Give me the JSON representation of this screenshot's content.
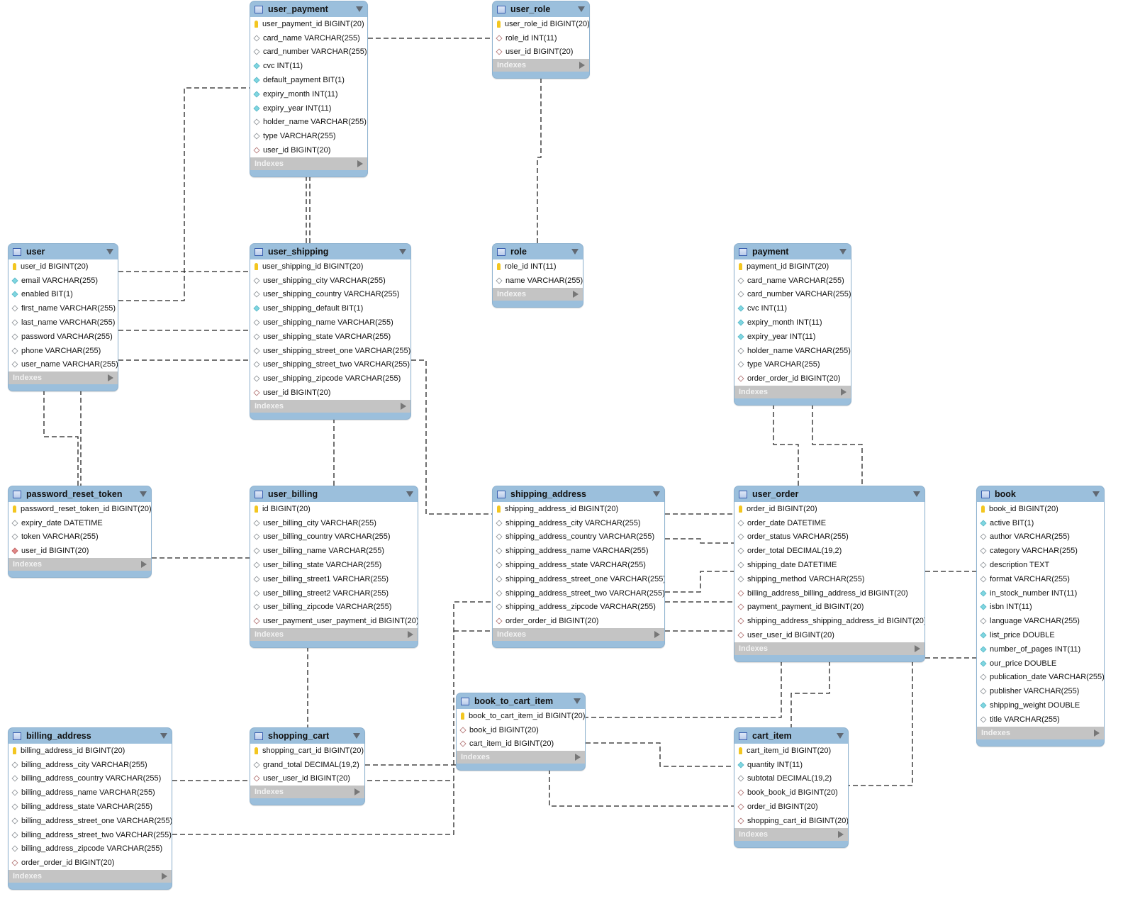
{
  "indexes_label": "Indexes",
  "colors": {
    "header": "#9bbfdc",
    "indexes": "#c4c4c4",
    "primary_key": "#f3c620",
    "not_null": "#7fd6e0",
    "foreign_key": "#b07070"
  },
  "icon_legend": {
    "pk": "key-icon",
    "col": "column-diamond-icon",
    "nn": "not-null-diamond-icon",
    "fk": "foreign-key-diamond-icon",
    "fknn": "foreign-key-filled-diamond-icon"
  },
  "tables": [
    {
      "id": "user_payment",
      "name": "user_payment",
      "columns": [
        {
          "text": "user_payment_id BIGINT(20)",
          "icon": "pk"
        },
        {
          "text": "card_name VARCHAR(255)",
          "icon": "col"
        },
        {
          "text": "card_number VARCHAR(255)",
          "icon": "col"
        },
        {
          "text": "cvc INT(11)",
          "icon": "nn"
        },
        {
          "text": "default_payment BIT(1)",
          "icon": "nn"
        },
        {
          "text": "expiry_month INT(11)",
          "icon": "nn"
        },
        {
          "text": "expiry_year INT(11)",
          "icon": "nn"
        },
        {
          "text": "holder_name VARCHAR(255)",
          "icon": "col"
        },
        {
          "text": "type VARCHAR(255)",
          "icon": "col"
        },
        {
          "text": "user_id BIGINT(20)",
          "icon": "fk"
        }
      ]
    },
    {
      "id": "user_role",
      "name": "user_role",
      "columns": [
        {
          "text": "user_role_id BIGINT(20)",
          "icon": "pk"
        },
        {
          "text": "role_id INT(11)",
          "icon": "fk"
        },
        {
          "text": "user_id BIGINT(20)",
          "icon": "fk"
        }
      ]
    },
    {
      "id": "user",
      "name": "user",
      "columns": [
        {
          "text": "user_id BIGINT(20)",
          "icon": "pk"
        },
        {
          "text": "email VARCHAR(255)",
          "icon": "nn"
        },
        {
          "text": "enabled BIT(1)",
          "icon": "nn"
        },
        {
          "text": "first_name VARCHAR(255)",
          "icon": "col"
        },
        {
          "text": "last_name VARCHAR(255)",
          "icon": "col"
        },
        {
          "text": "password VARCHAR(255)",
          "icon": "col"
        },
        {
          "text": "phone VARCHAR(255)",
          "icon": "col"
        },
        {
          "text": "user_name VARCHAR(255)",
          "icon": "col"
        }
      ]
    },
    {
      "id": "user_shipping",
      "name": "user_shipping",
      "columns": [
        {
          "text": "user_shipping_id BIGINT(20)",
          "icon": "pk"
        },
        {
          "text": "user_shipping_city VARCHAR(255)",
          "icon": "col"
        },
        {
          "text": "user_shipping_country VARCHAR(255)",
          "icon": "col"
        },
        {
          "text": "user_shipping_default BIT(1)",
          "icon": "nn"
        },
        {
          "text": "user_shipping_name VARCHAR(255)",
          "icon": "col"
        },
        {
          "text": "user_shipping_state VARCHAR(255)",
          "icon": "col"
        },
        {
          "text": "user_shipping_street_one VARCHAR(255)",
          "icon": "col"
        },
        {
          "text": "user_shipping_street_two VARCHAR(255)",
          "icon": "col"
        },
        {
          "text": "user_shipping_zipcode VARCHAR(255)",
          "icon": "col"
        },
        {
          "text": "user_id BIGINT(20)",
          "icon": "fk"
        }
      ]
    },
    {
      "id": "role",
      "name": "role",
      "columns": [
        {
          "text": "role_id INT(11)",
          "icon": "pk"
        },
        {
          "text": "name VARCHAR(255)",
          "icon": "col"
        }
      ]
    },
    {
      "id": "payment",
      "name": "payment",
      "columns": [
        {
          "text": "payment_id BIGINT(20)",
          "icon": "pk"
        },
        {
          "text": "card_name VARCHAR(255)",
          "icon": "col"
        },
        {
          "text": "card_number VARCHAR(255)",
          "icon": "col"
        },
        {
          "text": "cvc INT(11)",
          "icon": "nn"
        },
        {
          "text": "expiry_month INT(11)",
          "icon": "nn"
        },
        {
          "text": "expiry_year INT(11)",
          "icon": "nn"
        },
        {
          "text": "holder_name VARCHAR(255)",
          "icon": "col"
        },
        {
          "text": "type VARCHAR(255)",
          "icon": "col"
        },
        {
          "text": "order_order_id BIGINT(20)",
          "icon": "fk"
        }
      ]
    },
    {
      "id": "password_reset_token",
      "name": "password_reset_token",
      "columns": [
        {
          "text": "password_reset_token_id BIGINT(20)",
          "icon": "pk"
        },
        {
          "text": "expiry_date DATETIME",
          "icon": "col"
        },
        {
          "text": "token VARCHAR(255)",
          "icon": "col"
        },
        {
          "text": "user_id BIGINT(20)",
          "icon": "fknn"
        }
      ]
    },
    {
      "id": "user_billing",
      "name": "user_billing",
      "columns": [
        {
          "text": "id BIGINT(20)",
          "icon": "pk"
        },
        {
          "text": "user_billing_city VARCHAR(255)",
          "icon": "col"
        },
        {
          "text": "user_billing_country VARCHAR(255)",
          "icon": "col"
        },
        {
          "text": "user_billing_name VARCHAR(255)",
          "icon": "col"
        },
        {
          "text": "user_billing_state VARCHAR(255)",
          "icon": "col"
        },
        {
          "text": "user_billing_street1 VARCHAR(255)",
          "icon": "col"
        },
        {
          "text": "user_billing_street2 VARCHAR(255)",
          "icon": "col"
        },
        {
          "text": "user_billing_zipcode VARCHAR(255)",
          "icon": "col"
        },
        {
          "text": "user_payment_user_payment_id BIGINT(20)",
          "icon": "fk"
        }
      ]
    },
    {
      "id": "shipping_address",
      "name": "shipping_address",
      "columns": [
        {
          "text": "shipping_address_id BIGINT(20)",
          "icon": "pk"
        },
        {
          "text": "shipping_address_city VARCHAR(255)",
          "icon": "col"
        },
        {
          "text": "shipping_address_country VARCHAR(255)",
          "icon": "col"
        },
        {
          "text": "shipping_address_name VARCHAR(255)",
          "icon": "col"
        },
        {
          "text": "shipping_address_state VARCHAR(255)",
          "icon": "col"
        },
        {
          "text": "shipping_address_street_one VARCHAR(255)",
          "icon": "col"
        },
        {
          "text": "shipping_address_street_two VARCHAR(255)",
          "icon": "col"
        },
        {
          "text": "shipping_address_zipcode VARCHAR(255)",
          "icon": "col"
        },
        {
          "text": "order_order_id BIGINT(20)",
          "icon": "fk"
        }
      ]
    },
    {
      "id": "user_order",
      "name": "user_order",
      "columns": [
        {
          "text": "order_id BIGINT(20)",
          "icon": "pk"
        },
        {
          "text": "order_date DATETIME",
          "icon": "col"
        },
        {
          "text": "order_status VARCHAR(255)",
          "icon": "col"
        },
        {
          "text": "order_total DECIMAL(19,2)",
          "icon": "col"
        },
        {
          "text": "shipping_date DATETIME",
          "icon": "col"
        },
        {
          "text": "shipping_method VARCHAR(255)",
          "icon": "col"
        },
        {
          "text": "billing_address_billing_address_id BIGINT(20)",
          "icon": "fk"
        },
        {
          "text": "payment_payment_id BIGINT(20)",
          "icon": "fk"
        },
        {
          "text": "shipping_address_shipping_address_id BIGINT(20)",
          "icon": "fk"
        },
        {
          "text": "user_user_id BIGINT(20)",
          "icon": "fk"
        }
      ]
    },
    {
      "id": "book",
      "name": "book",
      "columns": [
        {
          "text": "book_id BIGINT(20)",
          "icon": "pk"
        },
        {
          "text": "active BIT(1)",
          "icon": "nn"
        },
        {
          "text": "author VARCHAR(255)",
          "icon": "col"
        },
        {
          "text": "category VARCHAR(255)",
          "icon": "col"
        },
        {
          "text": "description TEXT",
          "icon": "col"
        },
        {
          "text": "format VARCHAR(255)",
          "icon": "col"
        },
        {
          "text": "in_stock_number INT(11)",
          "icon": "nn"
        },
        {
          "text": "isbn INT(11)",
          "icon": "nn"
        },
        {
          "text": "language VARCHAR(255)",
          "icon": "col"
        },
        {
          "text": "list_price DOUBLE",
          "icon": "nn"
        },
        {
          "text": "number_of_pages INT(11)",
          "icon": "nn"
        },
        {
          "text": "our_price DOUBLE",
          "icon": "nn"
        },
        {
          "text": "publication_date VARCHAR(255)",
          "icon": "col"
        },
        {
          "text": "publisher VARCHAR(255)",
          "icon": "col"
        },
        {
          "text": "shipping_weight DOUBLE",
          "icon": "nn"
        },
        {
          "text": "title VARCHAR(255)",
          "icon": "col"
        }
      ]
    },
    {
      "id": "book_to_cart_item",
      "name": "book_to_cart_item",
      "columns": [
        {
          "text": "book_to_cart_item_id BIGINT(20)",
          "icon": "pk"
        },
        {
          "text": "book_id BIGINT(20)",
          "icon": "fk"
        },
        {
          "text": "cart_item_id BIGINT(20)",
          "icon": "fk"
        }
      ]
    },
    {
      "id": "billing_address",
      "name": "billing_address",
      "columns": [
        {
          "text": "billing_address_id BIGINT(20)",
          "icon": "pk"
        },
        {
          "text": "billing_address_city VARCHAR(255)",
          "icon": "col"
        },
        {
          "text": "billing_address_country VARCHAR(255)",
          "icon": "col"
        },
        {
          "text": "billing_address_name VARCHAR(255)",
          "icon": "col"
        },
        {
          "text": "billing_address_state VARCHAR(255)",
          "icon": "col"
        },
        {
          "text": "billing_address_street_one VARCHAR(255)",
          "icon": "col"
        },
        {
          "text": "billing_address_street_two VARCHAR(255)",
          "icon": "col"
        },
        {
          "text": "billing_address_zipcode VARCHAR(255)",
          "icon": "col"
        },
        {
          "text": "order_order_id BIGINT(20)",
          "icon": "fk"
        }
      ]
    },
    {
      "id": "shopping_cart",
      "name": "shopping_cart",
      "columns": [
        {
          "text": "shopping_cart_id BIGINT(20)",
          "icon": "pk"
        },
        {
          "text": "grand_total DECIMAL(19,2)",
          "icon": "col"
        },
        {
          "text": "user_user_id BIGINT(20)",
          "icon": "fk"
        }
      ]
    },
    {
      "id": "cart_item",
      "name": "cart_item",
      "columns": [
        {
          "text": "cart_item_id BIGINT(20)",
          "icon": "pk"
        },
        {
          "text": "quantity INT(11)",
          "icon": "nn"
        },
        {
          "text": "subtotal DECIMAL(19,2)",
          "icon": "col"
        },
        {
          "text": "book_book_id BIGINT(20)",
          "icon": "fk"
        },
        {
          "text": "order_id BIGINT(20)",
          "icon": "fk"
        },
        {
          "text": "shopping_cart_id BIGINT(20)",
          "icon": "fk"
        }
      ]
    }
  ]
}
